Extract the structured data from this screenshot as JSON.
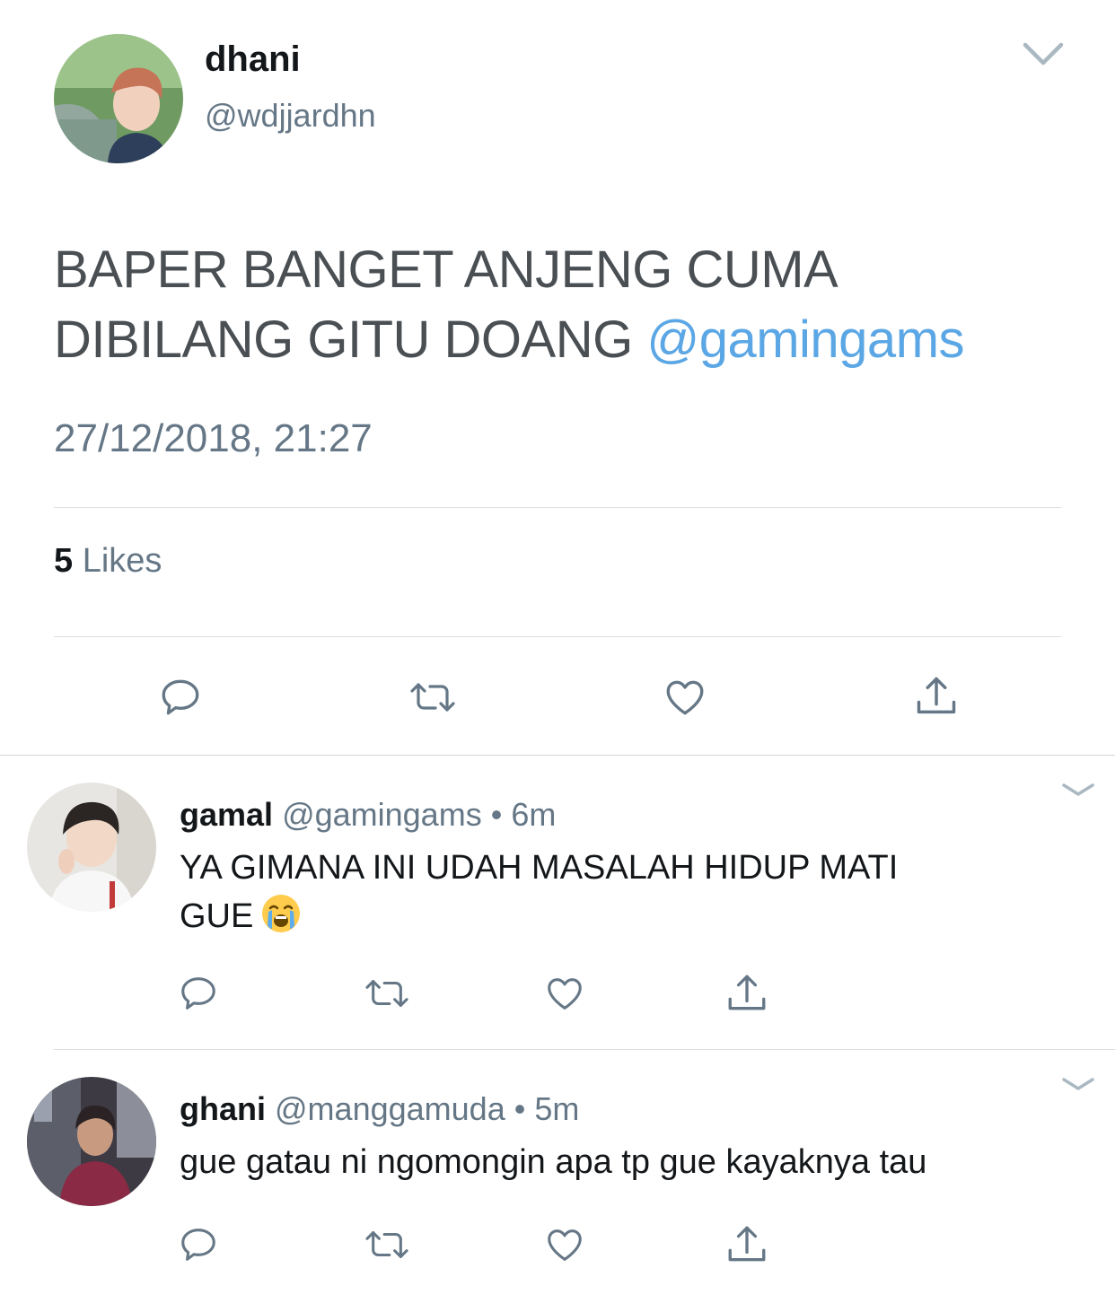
{
  "main_tweet": {
    "name": "dhani",
    "handle": "@wdjjardhn",
    "text": "BAPER BANGET ANJENG CUMA DIBILANG GITU DOANG ",
    "mention": "@gamingams",
    "timestamp": "27/12/2018, 21:27",
    "likes_count": "5",
    "likes_label": "Likes"
  },
  "replies": [
    {
      "name": "gamal",
      "handle": "@gamingams",
      "time": "6m",
      "text_line1": "YA GIMANA INI UDAH MASALAH HIDUP MATI",
      "text_line2": "GUE",
      "emoji": "loudly-crying-face"
    },
    {
      "name": "ghani",
      "handle": "@manggamuda",
      "time": "5m",
      "text_line1": "gue gatau ni ngomongin apa tp gue kayaknya tau"
    }
  ],
  "separator": "•",
  "colors": {
    "mention": "#5ba7e5",
    "secondary_text": "#657786",
    "icon": "#657786",
    "divider": "#dcdfe2"
  },
  "icons": [
    "reply-icon",
    "retweet-icon",
    "like-icon",
    "share-icon",
    "chevron-down-icon"
  ]
}
